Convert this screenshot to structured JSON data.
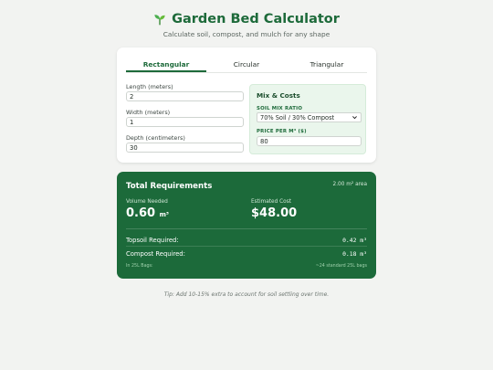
{
  "header": {
    "title": "Garden Bed Calculator",
    "subtitle": "Calculate soil, compost, and mulch for any shape",
    "icon": "sprout-icon"
  },
  "tabs": [
    {
      "label": "Rectangular",
      "active": true
    },
    {
      "label": "Circular",
      "active": false
    },
    {
      "label": "Triangular",
      "active": false
    }
  ],
  "fields": {
    "length": {
      "label": "Length (meters)",
      "value": "2"
    },
    "width": {
      "label": "Width (meters)",
      "value": "1"
    },
    "depth": {
      "label": "Depth (centimeters)",
      "value": "30"
    }
  },
  "mix": {
    "title": "Mix & Costs",
    "ratio_label": "SOIL MIX RATIO",
    "ratio_value": "70% Soil / 30% Compost",
    "price_label": "PRICE PER M³ ($)",
    "price_value": "80"
  },
  "results": {
    "title": "Total Requirements",
    "area": "2.00 m² area",
    "volume_label": "Volume Needed",
    "volume_value": "0.60",
    "volume_unit": "m³",
    "cost_label": "Estimated Cost",
    "cost_value": "$48.00",
    "topsoil_label": "Topsoil Required:",
    "topsoil_value": "0.42 m³",
    "compost_label": "Compost Required:",
    "compost_value": "0.18 m³",
    "bags_left": "In 25L Bags:",
    "bags_right": "~24 standard 25L bags"
  },
  "tip": "Tip: Add 10-15% extra to account for soil settling over time.",
  "colors": {
    "accent": "#1d6a3a",
    "results_bg": "#1c6a3a",
    "panel_bg": "#eaf6ec",
    "page_bg": "#f2f3f1"
  }
}
